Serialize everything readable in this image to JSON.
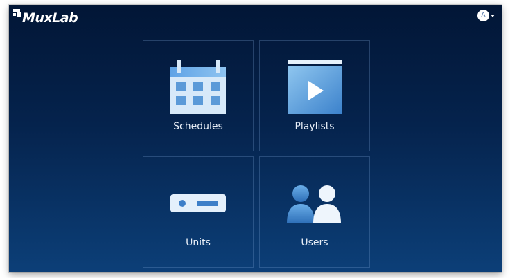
{
  "app": {
    "brand": "MuxLab"
  },
  "account": {
    "avatar_initial": "A",
    "icon": "chevron-down-icon"
  },
  "tiles": [
    {
      "label": "Schedules",
      "icon": "calendar-icon"
    },
    {
      "label": "Playlists",
      "icon": "playlist-play-icon"
    },
    {
      "label": "Units",
      "icon": "device-unit-icon"
    },
    {
      "label": "Users",
      "icon": "users-icon"
    }
  ],
  "colors": {
    "background_top": "#021636",
    "background_bottom": "#0c3f78",
    "icon_light": "#cfe3f7",
    "icon_mid": "#6aa9e4",
    "icon_dark": "#2f6fb6",
    "text": "#e8eef7"
  }
}
